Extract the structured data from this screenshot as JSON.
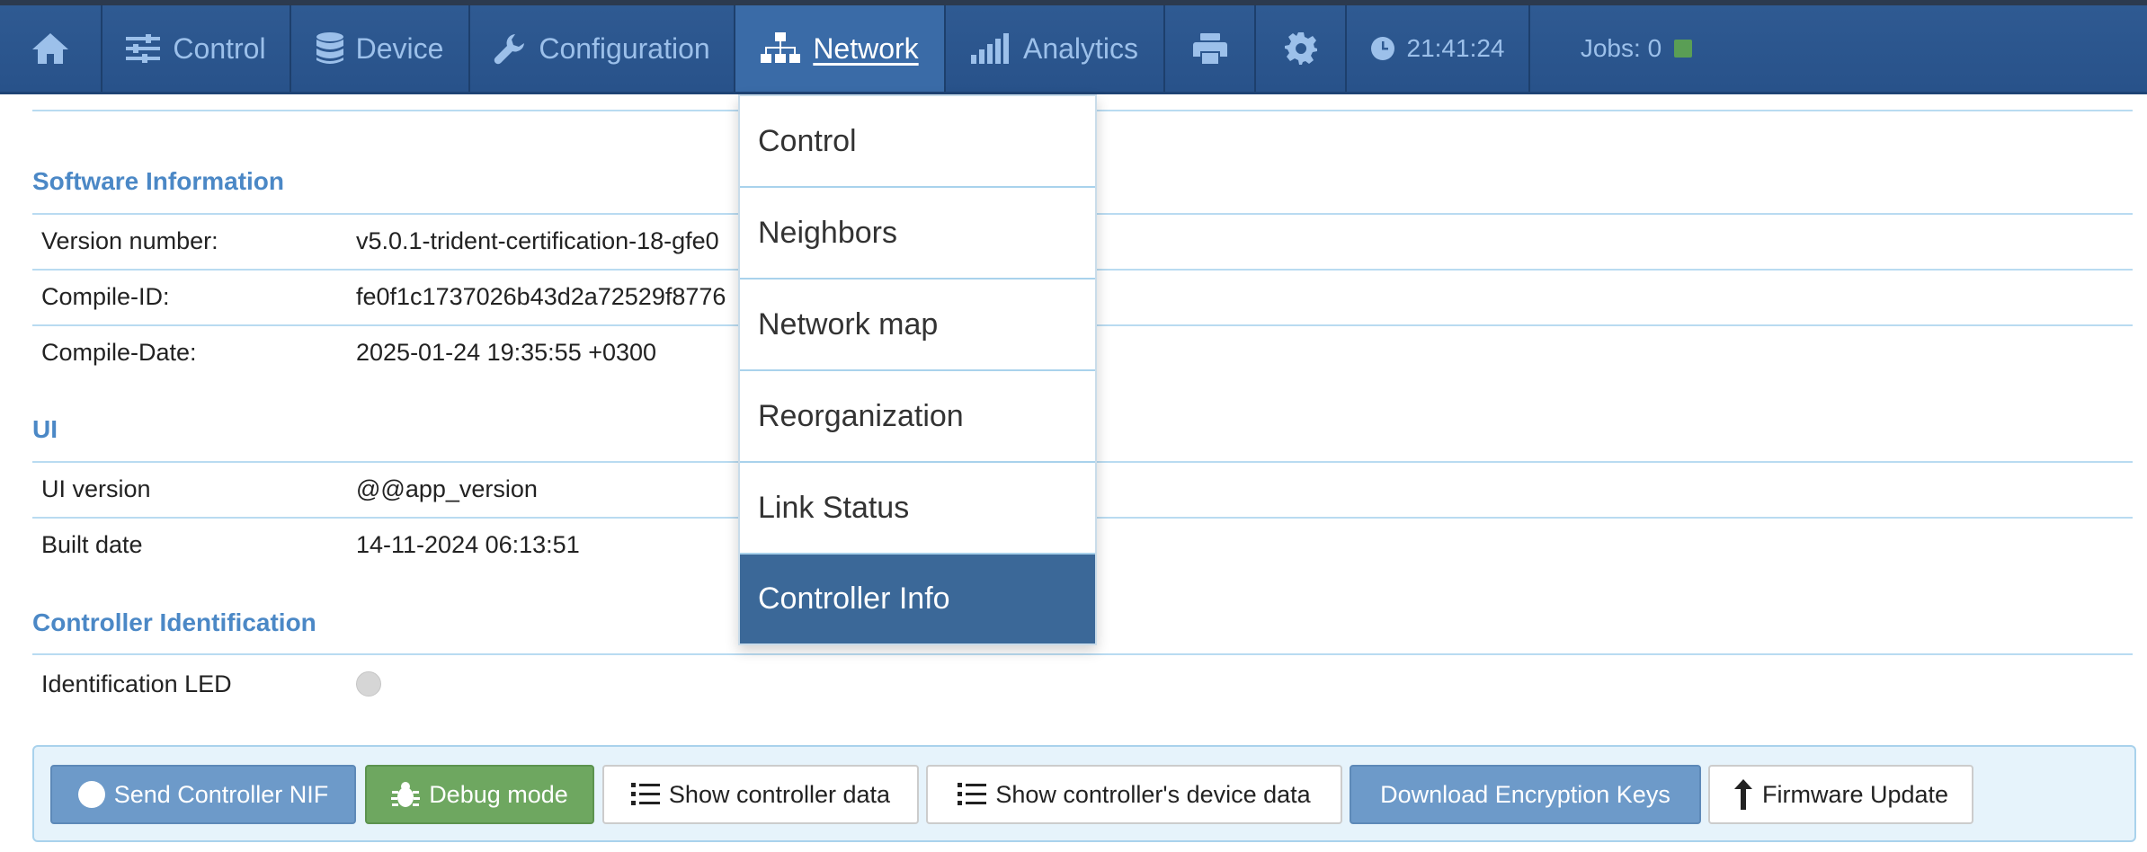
{
  "navbar": {
    "items": [
      {
        "id": "home",
        "label": "",
        "icon": "home-icon"
      },
      {
        "id": "control",
        "label": "Control",
        "icon": "sliders-icon"
      },
      {
        "id": "device",
        "label": "Device",
        "icon": "database-icon"
      },
      {
        "id": "configuration",
        "label": "Configuration",
        "icon": "wrench-icon"
      },
      {
        "id": "network",
        "label": "Network",
        "icon": "sitemap-icon",
        "active": true
      },
      {
        "id": "analytics",
        "label": "Analytics",
        "icon": "signal-bars-icon"
      },
      {
        "id": "print",
        "label": "",
        "icon": "printer-icon"
      },
      {
        "id": "settings",
        "label": "",
        "icon": "gear-icon"
      }
    ],
    "clock": "21:41:24",
    "jobs_label": "Jobs: 0",
    "jobs_led_color": "#5a9e55"
  },
  "network_menu": {
    "items": [
      {
        "label": "Control"
      },
      {
        "label": "Neighbors"
      },
      {
        "label": "Network map"
      },
      {
        "label": "Reorganization"
      },
      {
        "label": "Link Status"
      },
      {
        "label": "Controller Info",
        "active": true
      }
    ]
  },
  "software_info": {
    "title": "Software Information",
    "rows": [
      {
        "key": "Version number:",
        "value": "v5.0.1-trident-certification-18-gfe0"
      },
      {
        "key": "Compile-ID:",
        "value": "fe0f1c1737026b43d2a72529f8776"
      },
      {
        "key": "Compile-Date:",
        "value": "2025-01-24 19:35:55 +0300"
      }
    ]
  },
  "ui_info": {
    "title": "UI",
    "rows": [
      {
        "key": "UI version",
        "value": "@@app_version"
      },
      {
        "key": "Built date",
        "value": "14-11-2024 06:13:51"
      }
    ]
  },
  "controller_identification": {
    "title": "Controller Identification",
    "led_label": "Identification LED",
    "led_color": "#d6d6d6"
  },
  "actions": {
    "send_nif": "Send Controller NIF",
    "debug_mode": "Debug mode",
    "show_controller_data": "Show controller data",
    "show_device_data": "Show controller's device data",
    "download_keys": "Download Encryption Keys",
    "firmware_update": "Firmware Update"
  },
  "colors": {
    "navbar_bg": "#2f5a92",
    "nav_text": "#9cc0ea",
    "section_title": "#4b88c6",
    "menu_active": "#3b6898",
    "btn_primary": "#6d9ac9",
    "btn_success": "#6ea760"
  }
}
